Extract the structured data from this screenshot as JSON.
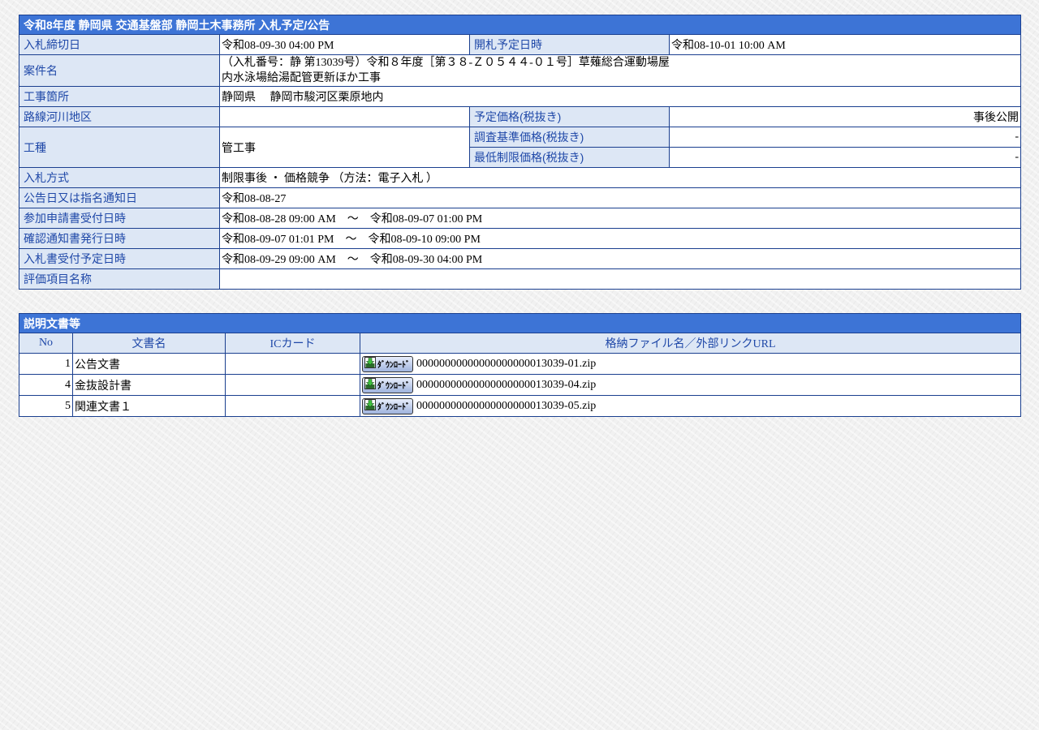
{
  "title": "令和8年度 静岡県 交通基盤部 静岡土木事務所 入札予定/公告",
  "labels": {
    "deadline": "入札締切日",
    "opening": "開札予定日時",
    "case_name": "案件名",
    "location": "工事箇所",
    "route": "路線河川地区",
    "planned_price": "予定価格(税抜き)",
    "work_type": "工種",
    "survey_price": "調査基準価格(税抜き)",
    "min_price": "最低制限価格(税抜き)",
    "bid_method": "入札方式",
    "notice_date": "公告日又は指名通知日",
    "participation": "参加申請書受付日時",
    "confirmation": "確認通知書発行日時",
    "bid_receipt": "入札書受付予定日時",
    "eval_items": "評価項目名称"
  },
  "values": {
    "deadline": "令和08-09-30 04:00 PM",
    "opening": "令和08-10-01 10:00 AM",
    "case_name_line1": "（入札番号：静 第13039号）令和８年度［第３８-Ｚ０５４４-０１号］草薙総合運動場屋",
    "case_name_line2": "内水泳場給湯配管更新ほか工事",
    "location": "静岡県　 静岡市駿河区栗原地内",
    "route": "",
    "planned_price": "事後公開",
    "work_type": "管工事",
    "survey_price": "-",
    "min_price": "-",
    "bid_method": "制限事後 ・ 価格競争 （方法：電子入札 ）",
    "notice_date": "令和08-08-27",
    "participation": "令和08-08-28 09:00 AM　～　令和08-09-07 01:00 PM",
    "confirmation": "令和08-09-07 01:01 PM　～　令和08-09-10 09:00 PM",
    "bid_receipt": "令和08-09-29 09:00 AM　～　令和08-09-30 04:00 PM",
    "eval_items": ""
  },
  "docs": {
    "title": "説明文書等",
    "headers": {
      "no": "No",
      "name": "文書名",
      "ic": "ICカード",
      "file": "格納ファイル名／外部リンクURL"
    },
    "download_label": "ﾀﾞｳﾝﾛｰﾄﾞ",
    "rows": [
      {
        "no": "1",
        "name": "公告文書",
        "ic": "",
        "file": "00000000000000000000013039-01.zip"
      },
      {
        "no": "4",
        "name": "金抜設計書",
        "ic": "",
        "file": "00000000000000000000013039-04.zip"
      },
      {
        "no": "5",
        "name": "関連文書１",
        "ic": "",
        "file": "00000000000000000000013039-05.zip"
      }
    ]
  },
  "colors": {
    "title_bar": "#3d74d6",
    "label_bg": "#dde7f5",
    "label_text": "#1f48a8",
    "border": "#1a3f8f"
  },
  "icons": {
    "download": "download-arrow-icon"
  }
}
